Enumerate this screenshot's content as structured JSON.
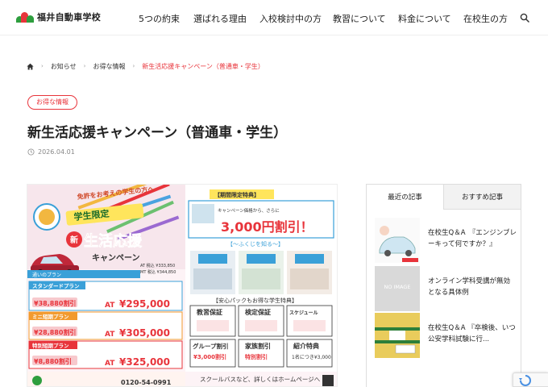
{
  "header": {
    "logo_text": "福井自動車学校",
    "nav": [
      "5つの約束",
      "選ばれる理由",
      "入校検討中の方",
      "教習について",
      "料金について",
      "在校生の方"
    ]
  },
  "breadcrumb": {
    "items": [
      "お知らせ",
      "お得な情報"
    ],
    "current": "新生活応援キャンペーン（普通車・学生）"
  },
  "article": {
    "category": "お得な情報",
    "title": "新生活応援キャンペーン（普通車・学生）",
    "date": "2026.04.01"
  },
  "flyer": {
    "headline_top": "免許をお考えの学生の方へ",
    "limited": "学生限定",
    "campaign_1": "生活応援",
    "campaign_2": "キャンペーン",
    "limited_offer_head": "【期間限定特典】",
    "discount_text": "3,000円割引！",
    "fukui_know": "【～ふくじを知る～】",
    "anshin_pack": "【安心パックもお得な学生特典】",
    "plan_standard": "スタンダードプラン",
    "plan_mini": "ミニ短期プラン",
    "plan_special": "特別短期プラン",
    "price_1": "¥295,000",
    "price_2": "¥305,000",
    "price_3": "¥325,000",
    "at_label": "AT",
    "strike_1": "¥38,880割引",
    "strike_2": "¥28,880割引",
    "strike_3": "¥8,880割引",
    "box_1": "教習保証",
    "box_2": "検定保証",
    "box_3": "スケジュール",
    "box_4": "グループ割引",
    "box_4_sub": "¥3,000割引",
    "box_5": "家族割引",
    "box_5_sub": "特別割引",
    "box_6": "紹介特典",
    "phone": "0120-54-0991",
    "footer_text": "スクールバスなど、詳しくはホームページへ"
  },
  "sidebar": {
    "tab_recent": "最近の記事",
    "tab_recommend": "おすすめ記事",
    "posts": [
      {
        "title": "在校生Q＆A　『エンジンブレーキって何ですか？』"
      },
      {
        "title": "オンライン学科受講が無効となる具体例",
        "thumb_label": "NO IMAGE"
      },
      {
        "title": "在校生Q＆A 『卒検後、いつ公安学科試験に行..."
      }
    ]
  },
  "colors": {
    "accent": "#e8343b",
    "logo_green": "#2e9e3e",
    "logo_red": "#e8343b"
  }
}
